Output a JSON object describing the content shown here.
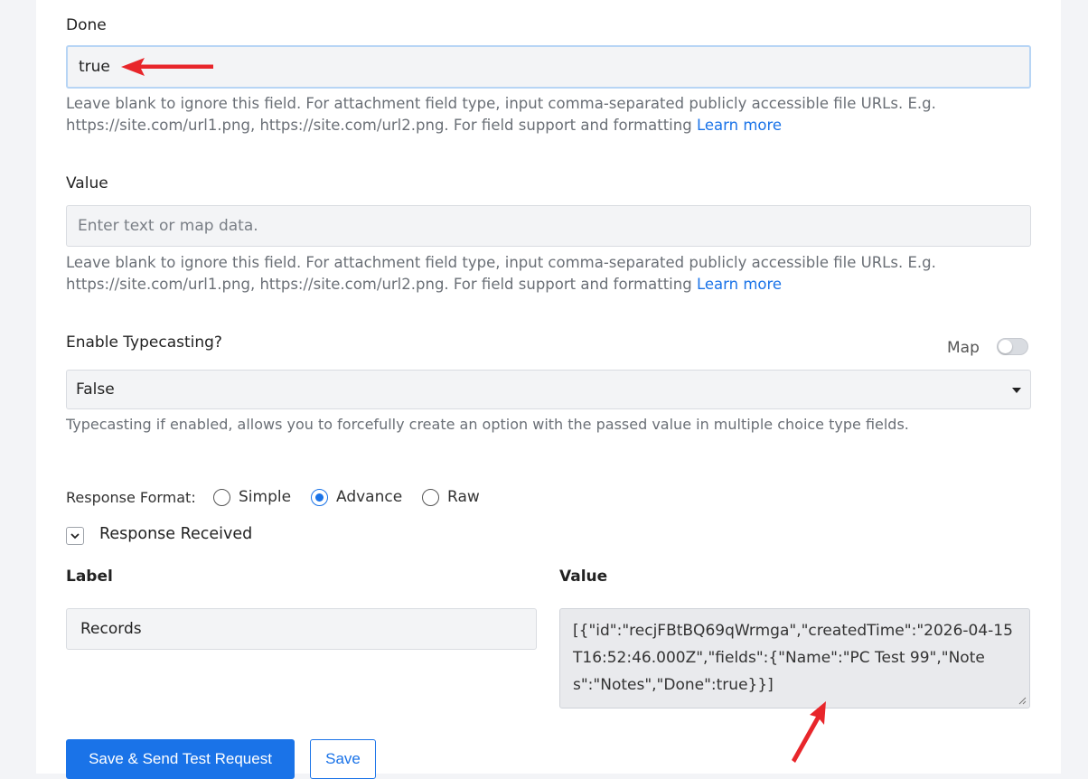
{
  "fields": {
    "done": {
      "label": "Done",
      "value": "true",
      "help_text": "Leave blank to ignore this field. For attachment field type, input comma-separated publicly accessible file URLs. E.g. https://site.com/url1.png, https://site.com/url2.png. For field support and formatting",
      "help_link": "Learn more"
    },
    "value": {
      "label": "Value",
      "placeholder": "Enter text or map data.",
      "help_text": "Leave blank to ignore this field. For attachment field type, input comma-separated publicly accessible file URLs. E.g. https://site.com/url1.png, https://site.com/url2.png. For field support and formatting",
      "help_link": "Learn more"
    },
    "typecasting": {
      "label": "Enable Typecasting?",
      "map_label": "Map",
      "selected": "False",
      "help_text": "Typecasting if enabled, allows you to forcefully create an option with the passed value in multiple choice type fields."
    }
  },
  "response_format": {
    "label": "Response Format:",
    "options": [
      "Simple",
      "Advance",
      "Raw"
    ],
    "selected": "Advance"
  },
  "response_received": {
    "title": "Response Received",
    "label_header": "Label",
    "value_header": "Value",
    "label_value": "Records",
    "response_value": "[{\"id\":\"recjFBtBQ69qWrmga\",\"createdTime\":\"2026-04-15T16:52:46.000Z\",\"fields\":{\"Name\":\"PC Test 99\",\"Notes\":\"Notes\",\"Done\":true}}]"
  },
  "actions": {
    "save_send": "Save & Send Test Request",
    "save": "Save"
  },
  "colors": {
    "accent": "#1a73e8",
    "annotation_arrow": "#e8262b"
  }
}
